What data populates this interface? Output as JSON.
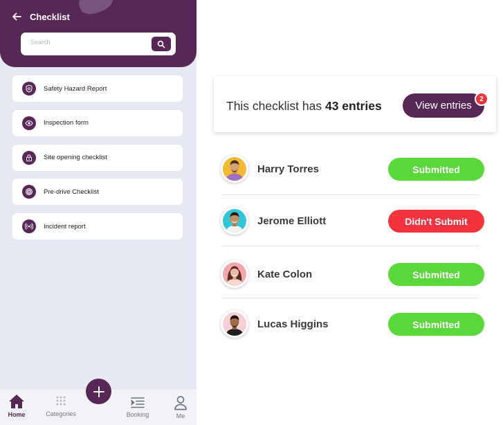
{
  "app": {
    "title": "Checklist",
    "search_placeholder": "Search"
  },
  "checklist_items": [
    {
      "label": "Safety Hazard Report",
      "icon": "shield-icon"
    },
    {
      "label": "Inspection form",
      "icon": "eye-icon"
    },
    {
      "label": "Site opening checklist",
      "icon": "lock-icon"
    },
    {
      "label": "Pre-drive Checklist",
      "icon": "fingerprint-icon"
    },
    {
      "label": "Incident report",
      "icon": "broadcast-icon"
    }
  ],
  "tabbar": {
    "tabs": [
      {
        "label": "Home",
        "icon": "home-icon"
      },
      {
        "label": "Categories",
        "icon": "grid-dots-icon"
      },
      {
        "label": "Booking",
        "icon": "list-indent-icon"
      },
      {
        "label": "Me",
        "icon": "user-icon"
      }
    ],
    "fab_icon": "plus-icon"
  },
  "summary": {
    "prefix": "This checklist has ",
    "count_text": "43 entries",
    "button_label": "View entries",
    "badge_count": "2"
  },
  "entries": [
    {
      "name": "Harry Torres",
      "status": "Submitted"
    },
    {
      "name": "Jerome Elliott",
      "status": "Didn't Submit"
    },
    {
      "name": "Kate Colon",
      "status": "Submitted"
    },
    {
      "name": "Lucas Higgins",
      "status": "Submitted"
    }
  ],
  "colors": {
    "brand": "#572856",
    "submitted": "#59d83a",
    "not_submitted": "#f5333f",
    "badge": "#f0323a"
  }
}
